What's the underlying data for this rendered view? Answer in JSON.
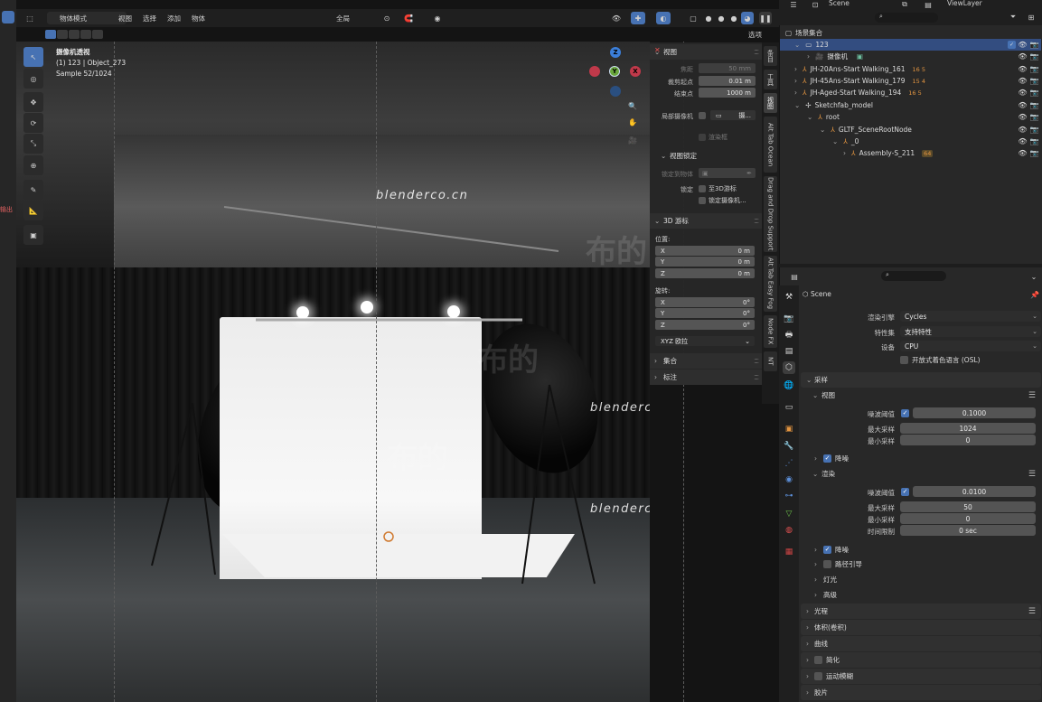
{
  "viewport": {
    "header": {
      "mode": "物体模式",
      "menu": [
        "视图",
        "选择",
        "添加",
        "物体"
      ],
      "transform_orientation": "全局",
      "options_label": "选项"
    },
    "info": {
      "view_name": "摄像机透视",
      "object": "(1) 123 | Object_273",
      "samples": "Sample 52/1024"
    },
    "watermarks": [
      "blenderco.cn",
      "blenderco.cn",
      "blenderco.cn"
    ],
    "cn_marks": [
      "布的",
      "布的",
      "布的"
    ],
    "gizmo": {
      "z": "Z",
      "y": "Y",
      "x": "X"
    },
    "left_edge_label": "输出"
  },
  "npanel": {
    "view": {
      "title": "视图",
      "focal_label": "焦距",
      "focal_value": "50 mm",
      "clip_start_label": "裁剪起点",
      "clip_start_value": "0.01 m",
      "clip_end_label": "结束点",
      "clip_end_value": "1000 m",
      "local_camera_label": "局部摄像机",
      "local_camera_value": "摄...",
      "render_region_label": "渲染框"
    },
    "view_lock": {
      "title": "视图锁定",
      "lock_to_object_label": "锁定到物体",
      "lock_label": "锁定",
      "to_3d_cursor": "至3D游标",
      "lock_camera": "锁定摄像机..."
    },
    "cursor": {
      "title": "3D 游标",
      "location_label": "位置:",
      "location": [
        {
          "axis": "X",
          "value": "0 m"
        },
        {
          "axis": "Y",
          "value": "0 m"
        },
        {
          "axis": "Z",
          "value": "0 m"
        }
      ],
      "rotation_label": "旋转:",
      "rotation": [
        {
          "axis": "X",
          "value": "0°"
        },
        {
          "axis": "Y",
          "value": "0°"
        },
        {
          "axis": "Z",
          "value": "0°"
        }
      ],
      "rotation_mode": "XYZ 欧拉"
    },
    "collection_title": "集合",
    "annotation_title": "标注",
    "tabs": [
      "条目",
      "工具",
      "视图",
      "Alt Tab Ocean",
      "Drag and Drop Support",
      "Alt Tab Easy Fog",
      "Node FX",
      "NT"
    ]
  },
  "outliner": {
    "header": {
      "scene": "Scene",
      "view_layer": "ViewLayer"
    },
    "root_label": "场景集合",
    "rows": [
      {
        "label": "123",
        "selected": true
      },
      {
        "label": "摄像机"
      },
      {
        "label": "JH-20Ans-Start Walking_161",
        "badge": "16 5"
      },
      {
        "label": "JH-45Ans-Start Walking_179",
        "badge": "15 4"
      },
      {
        "label": "JH-Aged-Start Walking_194",
        "badge": "16 5"
      },
      {
        "label": "Sketchfab_model"
      },
      {
        "label": "root"
      },
      {
        "label": "GLTF_SceneRootNode"
      },
      {
        "label": "_0"
      },
      {
        "label": "Assembly-S_211",
        "badge": "64"
      }
    ]
  },
  "properties": {
    "scene_name": "Scene",
    "render_engine_label": "渲染引擎",
    "render_engine": "Cycles",
    "feature_set_label": "特性集",
    "feature_set": "支持特性",
    "device_label": "设备",
    "device": "CPU",
    "osl_label": "开放式着色语言 (OSL)",
    "sampling": {
      "title": "采样",
      "viewport": {
        "title": "视图",
        "noise_threshold_label": "噪波阈值",
        "noise_threshold": "0.1000",
        "max_samples_label": "最大采样",
        "max_samples": "1024",
        "min_samples_label": "最小采样",
        "min_samples": "0"
      },
      "denoise_label": "降噪",
      "render": {
        "title": "渲染",
        "noise_threshold_label": "噪波阈值",
        "noise_threshold": "0.0100",
        "max_samples_label": "最大采样",
        "max_samples": "50",
        "min_samples_label": "最小采样",
        "min_samples": "0",
        "time_limit_label": "时间限制",
        "time_limit": "0 sec"
      },
      "denoise2_label": "降噪",
      "path_guiding_label": "路径引导",
      "lights_label": "灯光",
      "advanced_label": "高级"
    },
    "sections": [
      "光程",
      "体积(卷积)",
      "曲线",
      "简化",
      "运动模糊",
      "胶片"
    ]
  }
}
